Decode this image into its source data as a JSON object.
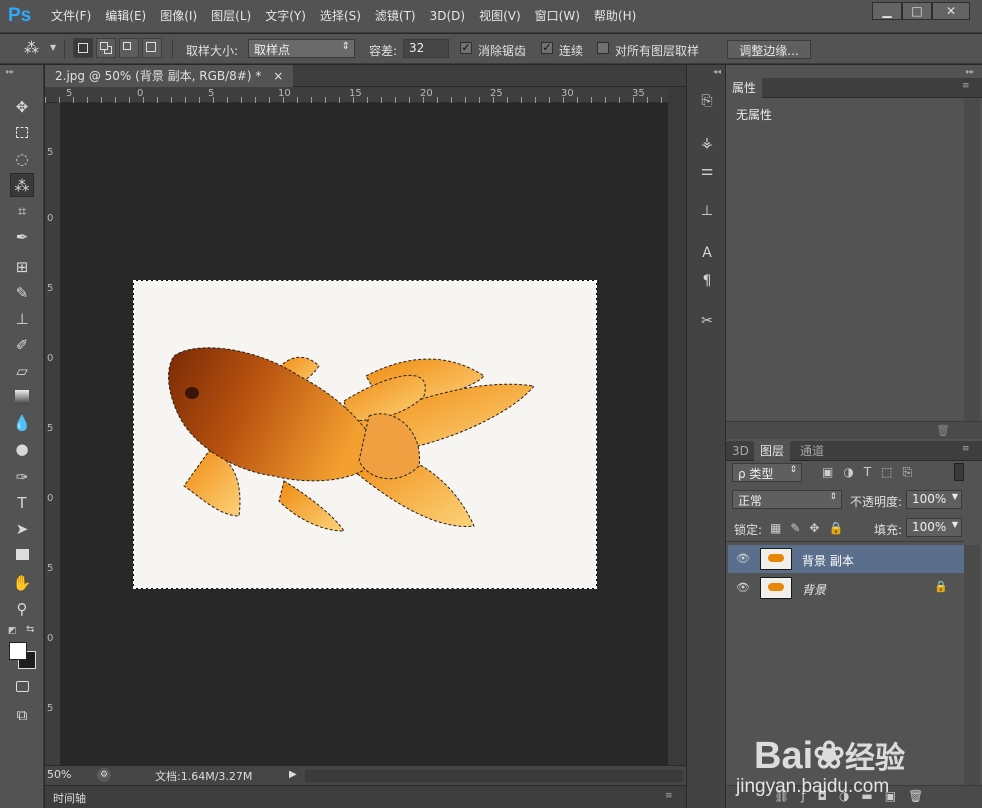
{
  "app": {
    "logo": "Ps"
  },
  "menu": [
    "文件(F)",
    "编辑(E)",
    "图像(I)",
    "图层(L)",
    "文字(Y)",
    "选择(S)",
    "滤镜(T)",
    "3D(D)",
    "视图(V)",
    "窗口(W)",
    "帮助(H)"
  ],
  "window_controls": {
    "minimize": "▁",
    "maximize": "□",
    "close": "✕"
  },
  "options": {
    "sample_size_label": "取样大小:",
    "sample_size_value": "取样点",
    "tolerance_label": "容差:",
    "tolerance_value": "32",
    "antialias_label": "消除锯齿",
    "contiguous_label": "连续",
    "sample_all_label": "对所有图层取样",
    "refine_edge_label": "调整边缘..."
  },
  "document": {
    "tab_title": "2.jpg @ 50% (背景 副本, RGB/8#) *",
    "close": "×",
    "ruler_h": [
      "5",
      "0",
      "5",
      "10",
      "15",
      "20",
      "25",
      "30",
      "35"
    ],
    "ruler_v": [
      "5",
      "0",
      "5",
      "0",
      "5",
      "0",
      "5",
      "0",
      "5",
      "0",
      "5",
      "0",
      "5"
    ]
  },
  "status": {
    "zoom": "50%",
    "doc_info": "文档:1.64M/3.27M"
  },
  "timeline": {
    "label": "时间轴"
  },
  "properties": {
    "tab": "属性",
    "content": "无属性"
  },
  "layers_panel": {
    "tabs": [
      "3D",
      "图层",
      "通道"
    ],
    "filter_label": "ρ 类型",
    "blend_mode": "正常",
    "opacity_label": "不透明度:",
    "opacity_value": "100%",
    "lock_label": "锁定:",
    "fill_label": "填充:",
    "fill_value": "100%",
    "layers": [
      {
        "name": "背景 副本",
        "selected": true
      },
      {
        "name": "背景",
        "selected": false
      }
    ]
  },
  "colors": {
    "ps_blue": "#31a8ff",
    "selection": "#5b6f8d",
    "goldfish": "#e8860a"
  },
  "watermark": {
    "text1": "Bai",
    "text2": "经验",
    "url": "jingyan.baidu.com"
  }
}
